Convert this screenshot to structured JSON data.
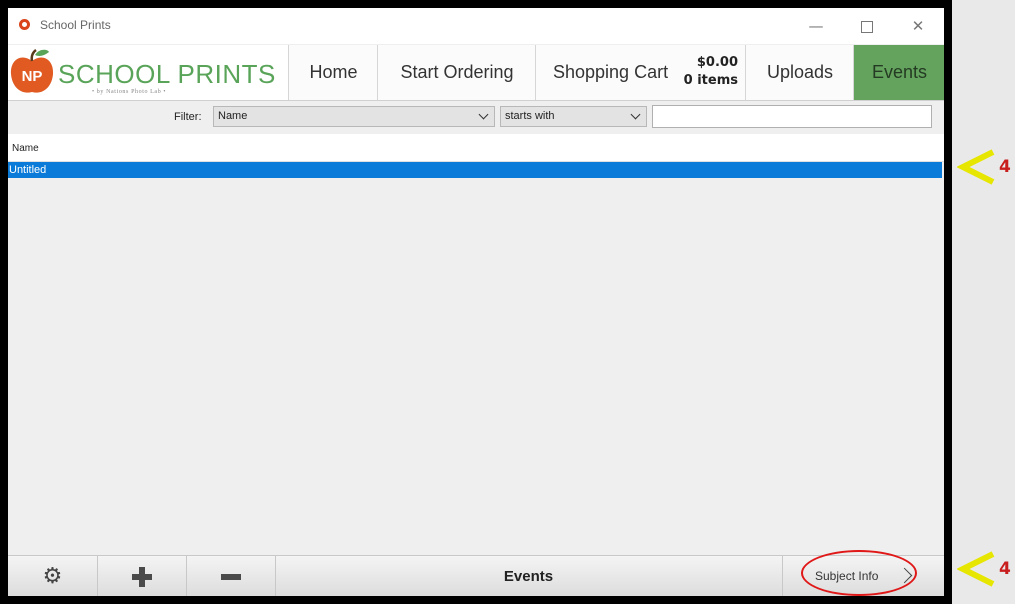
{
  "window": {
    "title": "School Prints",
    "controls": {
      "minimize": "—",
      "close": "✕"
    }
  },
  "logo": {
    "text": "SCHOOL PRINTS",
    "subtitle": "• by Nations Photo Lab •",
    "monogram": "NP"
  },
  "nav": {
    "tabs": [
      {
        "label": "Home"
      },
      {
        "label": "Start Ordering"
      },
      {
        "label": "Shopping Cart",
        "total": "$0.00",
        "items": "0 items"
      },
      {
        "label": "Uploads"
      },
      {
        "label": "Events",
        "active": true
      }
    ],
    "active_color": "#64a35e"
  },
  "filter": {
    "label": "Filter:",
    "field": "Name",
    "operator": "starts with",
    "value": ""
  },
  "list": {
    "columns": [
      "Name"
    ],
    "rows": [
      {
        "name": "Untitled",
        "selected": true
      }
    ],
    "selection_color": "#0a7bd8"
  },
  "toolbar": {
    "settings_icon": "gear-icon",
    "add_icon": "plus-icon",
    "remove_icon": "minus-icon",
    "title": "Events",
    "next_label": "Subject Info"
  },
  "annotations": [
    {
      "number": "4",
      "color": "#e6e600"
    },
    {
      "number": "4",
      "color": "#e6e600"
    }
  ]
}
